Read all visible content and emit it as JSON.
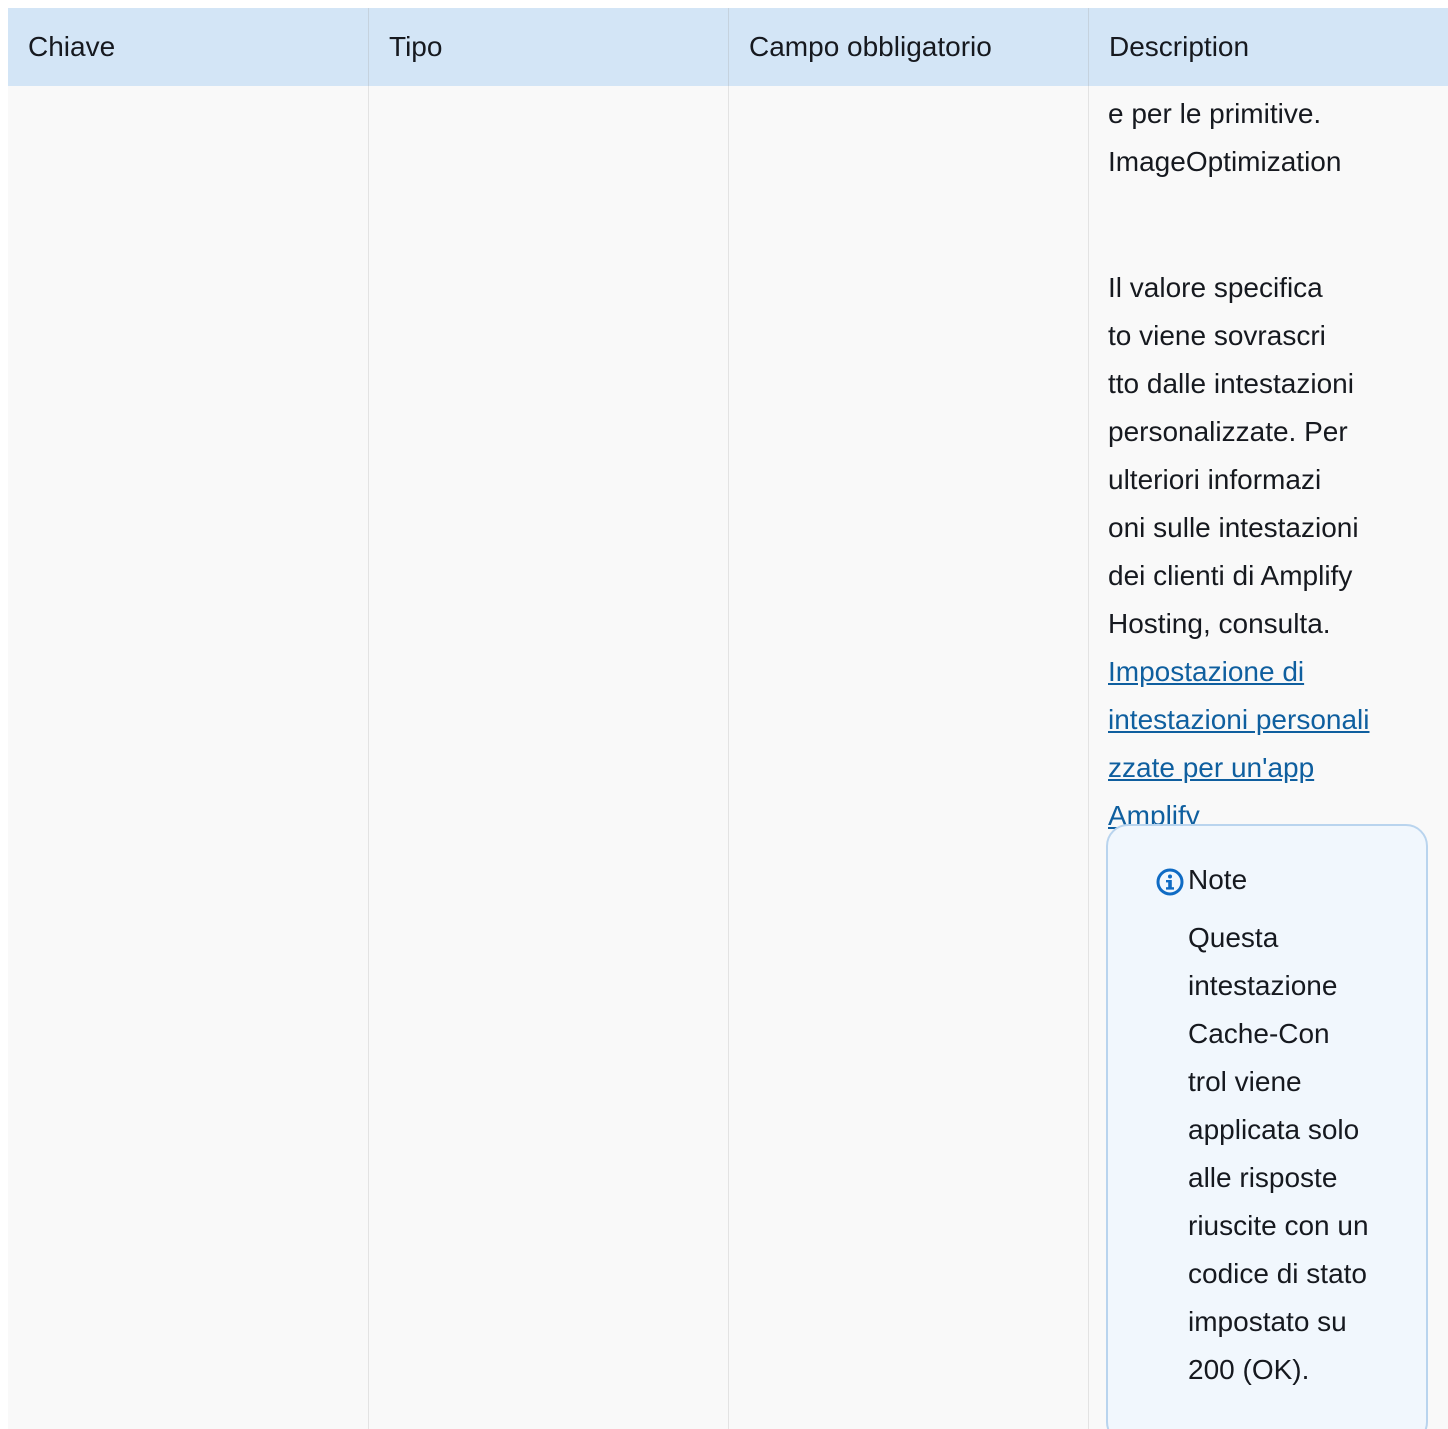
{
  "table": {
    "headers": [
      "Chiave",
      "Tipo",
      "Campo obbligatorio",
      "Description"
    ],
    "description_cell": {
      "fragment_top": "e per le primitive.\nImageOptimization",
      "paragraph": "Il valore specifica\nto viene sovrascri\ntto dalle intestazioni\npersonalizzate. Per\nulteriori informazi\noni sulle intestazioni\ndei clienti di Amplify\nHosting, consulta.",
      "link_text": "Impostazione di\nintestazioni personali\nzzate per un'app\nAmplify",
      "note": {
        "icon": "info-icon",
        "title": "Note",
        "body": "Questa\nintestazione\nCache-Con\ntrol viene\napplicata solo\nalle risposte\nriuscite con un\ncodice di stato\nimpostato su\n200 (OK)."
      }
    }
  },
  "colors": {
    "header_bg": "#d3e5f6",
    "row_bg": "#f9f9f9",
    "link": "#0f5f9f",
    "note_border": "#b9d4ee",
    "note_bg": "#f1f7fd",
    "icon": "#0f6bc4"
  }
}
